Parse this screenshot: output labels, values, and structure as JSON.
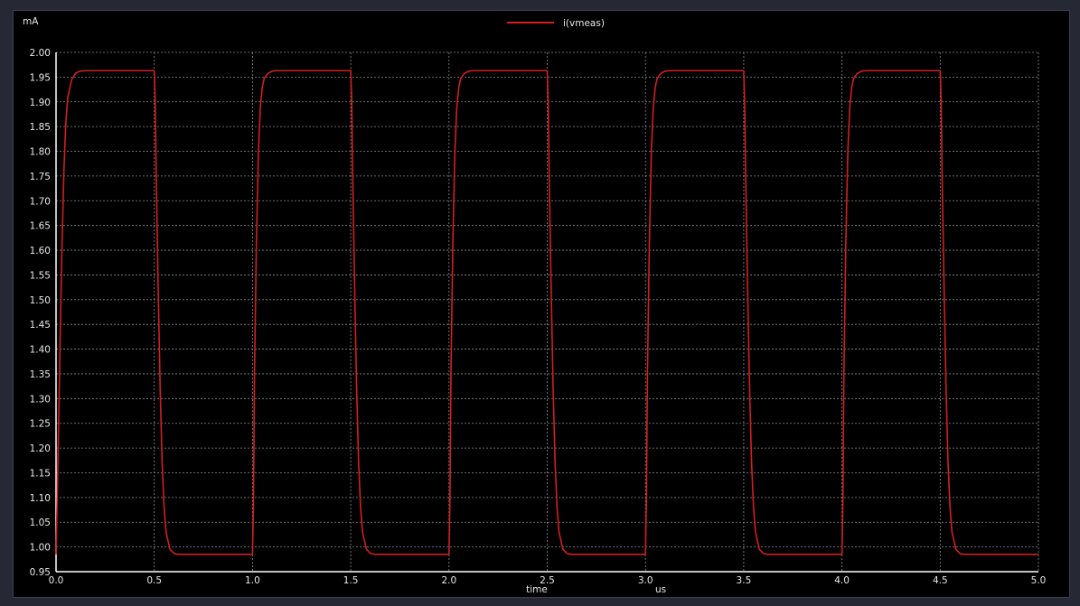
{
  "window": {
    "background": "#000000",
    "frame_color": "#262833"
  },
  "chart_data": {
    "type": "line",
    "xlabel": "time",
    "xunit": "us",
    "ylabel": "mA",
    "xlim": [
      0.0,
      5.0
    ],
    "ylim": [
      0.95,
      2.0
    ],
    "xticks": [
      "0.0",
      "0.5",
      "1.0",
      "1.5",
      "2.0",
      "2.5",
      "3.0",
      "3.5",
      "4.0",
      "4.5",
      "5.0"
    ],
    "xtick_values": [
      0.0,
      0.5,
      1.0,
      1.5,
      2.0,
      2.5,
      3.0,
      3.5,
      4.0,
      4.5,
      5.0
    ],
    "yticks": [
      "0.95",
      "1.00",
      "1.05",
      "1.10",
      "1.15",
      "1.20",
      "1.25",
      "1.30",
      "1.35",
      "1.40",
      "1.45",
      "1.50",
      "1.55",
      "1.60",
      "1.65",
      "1.70",
      "1.75",
      "1.80",
      "1.85",
      "1.90",
      "1.95",
      "2.00"
    ],
    "ytick_values": [
      0.95,
      1.0,
      1.05,
      1.1,
      1.15,
      1.2,
      1.25,
      1.3,
      1.35,
      1.4,
      1.45,
      1.5,
      1.55,
      1.6,
      1.65,
      1.7,
      1.75,
      1.8,
      1.85,
      1.9,
      1.95,
      2.0
    ],
    "grid": true,
    "legend_placement": "top-center",
    "series": [
      {
        "name": "i(vmeas)",
        "color": "#d21f1f",
        "x": [
          0.0,
          0.01,
          0.02,
          0.03,
          0.04,
          0.05,
          0.06,
          0.08,
          0.1,
          0.12,
          0.15,
          0.5,
          0.505,
          0.51,
          0.52,
          0.53,
          0.54,
          0.55,
          0.56,
          0.58,
          0.6,
          0.62,
          0.65,
          1.0,
          1.005,
          1.01,
          1.02,
          1.03,
          1.04,
          1.05,
          1.06,
          1.08,
          1.1,
          1.12,
          1.15,
          1.5,
          1.505,
          1.51,
          1.52,
          1.53,
          1.54,
          1.55,
          1.56,
          1.58,
          1.6,
          1.62,
          1.65,
          2.0,
          2.005,
          2.01,
          2.02,
          2.03,
          2.04,
          2.05,
          2.06,
          2.08,
          2.1,
          2.12,
          2.15,
          2.5,
          2.505,
          2.51,
          2.52,
          2.53,
          2.54,
          2.55,
          2.56,
          2.58,
          2.6,
          2.62,
          2.65,
          3.0,
          3.005,
          3.01,
          3.02,
          3.03,
          3.04,
          3.05,
          3.06,
          3.08,
          3.1,
          3.12,
          3.15,
          3.5,
          3.505,
          3.51,
          3.52,
          3.53,
          3.54,
          3.55,
          3.56,
          3.58,
          3.6,
          3.62,
          3.65,
          4.0,
          4.005,
          4.01,
          4.02,
          4.03,
          4.04,
          4.05,
          4.06,
          4.08,
          4.1,
          4.12,
          4.15,
          4.5,
          4.505,
          4.51,
          4.52,
          4.53,
          4.54,
          4.55,
          4.56,
          4.58,
          4.6,
          4.62,
          4.65,
          5.0
        ],
        "y": [
          0.985,
          1.18,
          1.4,
          1.6,
          1.76,
          1.86,
          1.91,
          1.945,
          1.958,
          1.962,
          1.963,
          1.963,
          1.9,
          1.75,
          1.52,
          1.32,
          1.17,
          1.08,
          1.03,
          0.995,
          0.987,
          0.985,
          0.985,
          0.985,
          1.1,
          1.35,
          1.62,
          1.8,
          1.89,
          1.93,
          1.948,
          1.958,
          1.962,
          1.963,
          1.963,
          1.963,
          1.9,
          1.75,
          1.52,
          1.32,
          1.17,
          1.08,
          1.03,
          0.995,
          0.987,
          0.985,
          0.985,
          0.985,
          1.1,
          1.35,
          1.62,
          1.8,
          1.89,
          1.93,
          1.948,
          1.958,
          1.962,
          1.963,
          1.963,
          1.963,
          1.9,
          1.75,
          1.52,
          1.32,
          1.17,
          1.08,
          1.03,
          0.995,
          0.987,
          0.985,
          0.985,
          0.985,
          1.1,
          1.35,
          1.62,
          1.8,
          1.89,
          1.93,
          1.948,
          1.958,
          1.962,
          1.963,
          1.963,
          1.963,
          1.9,
          1.75,
          1.52,
          1.32,
          1.17,
          1.08,
          1.03,
          0.995,
          0.987,
          0.985,
          0.985,
          0.985,
          1.1,
          1.35,
          1.62,
          1.8,
          1.89,
          1.93,
          1.948,
          1.958,
          1.962,
          1.963,
          1.963,
          1.963,
          1.9,
          1.75,
          1.52,
          1.32,
          1.17,
          1.08,
          1.03,
          0.995,
          0.987,
          0.985,
          0.985,
          0.985
        ]
      }
    ]
  }
}
